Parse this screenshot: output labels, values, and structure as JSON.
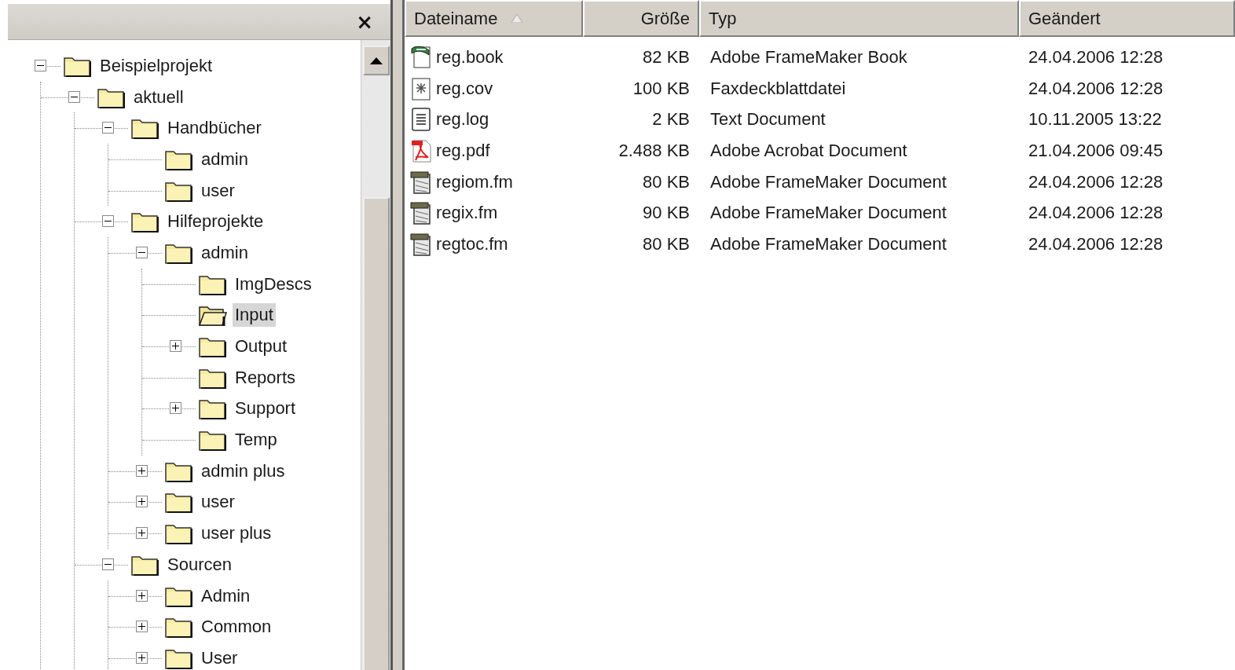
{
  "folder_pane": {
    "close_button": "×",
    "tree": [
      {
        "label": "Beispielprojekt",
        "expanded": true,
        "selected": false,
        "children": [
          {
            "label": "aktuell",
            "expanded": true,
            "selected": false,
            "children": [
              {
                "label": "Handbücher",
                "expanded": true,
                "selected": false,
                "children": [
                  {
                    "label": "admin",
                    "selected": false
                  },
                  {
                    "label": "user",
                    "selected": false
                  }
                ]
              },
              {
                "label": "Hilfeprojekte",
                "expanded": true,
                "selected": false,
                "children": [
                  {
                    "label": "admin",
                    "expanded": true,
                    "selected": false,
                    "children": [
                      {
                        "label": "ImgDescs",
                        "selected": false
                      },
                      {
                        "label": "Input",
                        "selected": true
                      },
                      {
                        "label": "Output",
                        "expanded": false,
                        "selected": false
                      },
                      {
                        "label": "Reports",
                        "selected": false
                      },
                      {
                        "label": "Support",
                        "expanded": false,
                        "selected": false
                      },
                      {
                        "label": "Temp",
                        "selected": false
                      }
                    ]
                  },
                  {
                    "label": "admin plus",
                    "expanded": false,
                    "selected": false
                  },
                  {
                    "label": "user",
                    "expanded": false,
                    "selected": false
                  },
                  {
                    "label": "user plus",
                    "expanded": false,
                    "selected": false
                  }
                ]
              },
              {
                "label": "Sourcen",
                "expanded": true,
                "selected": false,
                "children": [
                  {
                    "label": "Admin",
                    "expanded": false,
                    "selected": false
                  },
                  {
                    "label": "Common",
                    "expanded": false,
                    "selected": false
                  },
                  {
                    "label": "User",
                    "expanded": false,
                    "selected": false
                  }
                ]
              }
            ]
          }
        ]
      }
    ]
  },
  "file_list": {
    "columns": [
      {
        "label": "Dateiname",
        "sorted": true
      },
      {
        "label": "Größe",
        "sorted": false
      },
      {
        "label": "Typ",
        "sorted": false
      },
      {
        "label": "Geändert",
        "sorted": false
      }
    ],
    "rows": [
      {
        "kind": "book",
        "name": "reg.book",
        "size": "82 KB",
        "type": "Adobe FrameMaker Book",
        "modified": "24.04.2006 12:28"
      },
      {
        "kind": "fax",
        "name": "reg.cov",
        "size": "100 KB",
        "type": "Faxdeckblattdatei",
        "modified": "24.04.2006 12:28"
      },
      {
        "kind": "text",
        "name": "reg.log",
        "size": "2 KB",
        "type": "Text Document",
        "modified": "10.11.2005 13:22"
      },
      {
        "kind": "pdf",
        "name": "reg.pdf",
        "size": "2.488 KB",
        "type": "Adobe Acrobat Document",
        "modified": "21.04.2006 09:45"
      },
      {
        "kind": "fm",
        "name": "regiom.fm",
        "size": "80 KB",
        "type": "Adobe FrameMaker Document",
        "modified": "24.04.2006 12:28"
      },
      {
        "kind": "fm",
        "name": "regix.fm",
        "size": "90 KB",
        "type": "Adobe FrameMaker Document",
        "modified": "24.04.2006 12:28"
      },
      {
        "kind": "fm",
        "name": "regtoc.fm",
        "size": "80 KB",
        "type": "Adobe FrameMaker Document",
        "modified": "24.04.2006 12:28"
      }
    ]
  }
}
